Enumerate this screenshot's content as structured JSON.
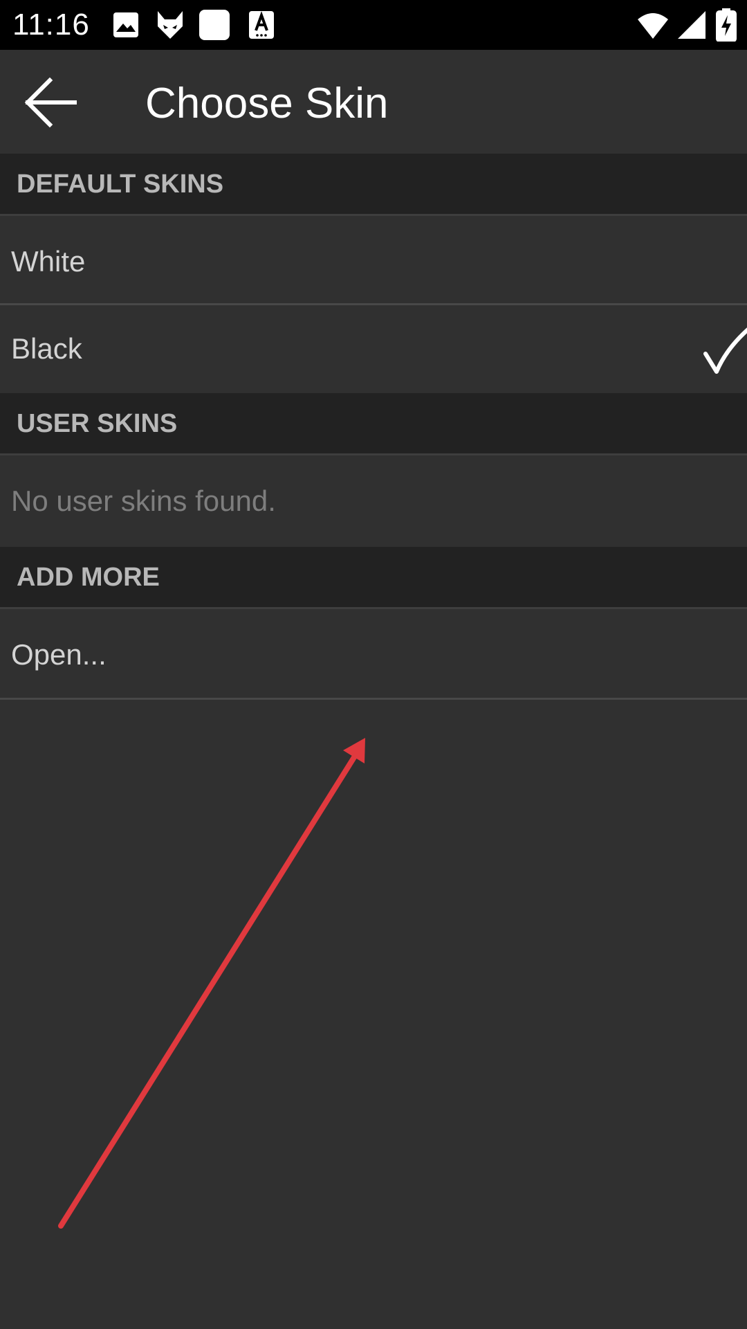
{
  "status_bar": {
    "time": "11:16",
    "icons": [
      "image-icon",
      "fox-icon",
      "white-square-icon",
      "font-a-icon",
      "wifi-icon",
      "signal-icon",
      "battery-charging-icon"
    ]
  },
  "app_bar": {
    "back_icon": "back-arrow-icon",
    "title": "Choose Skin"
  },
  "sections": [
    {
      "header": "DEFAULT SKINS",
      "items": [
        {
          "label": "White",
          "selected": false
        },
        {
          "label": "Black",
          "selected": true
        }
      ]
    },
    {
      "header": "USER SKINS",
      "items": [
        {
          "label": "No user skins found.",
          "selected": false
        }
      ]
    },
    {
      "header": "ADD MORE",
      "items": [
        {
          "label": "Open...",
          "selected": false
        }
      ]
    }
  ],
  "colors": {
    "background": "#303030",
    "status_bar": "#000000",
    "section_header": "#222222",
    "annotation_arrow": "#e0393e"
  }
}
